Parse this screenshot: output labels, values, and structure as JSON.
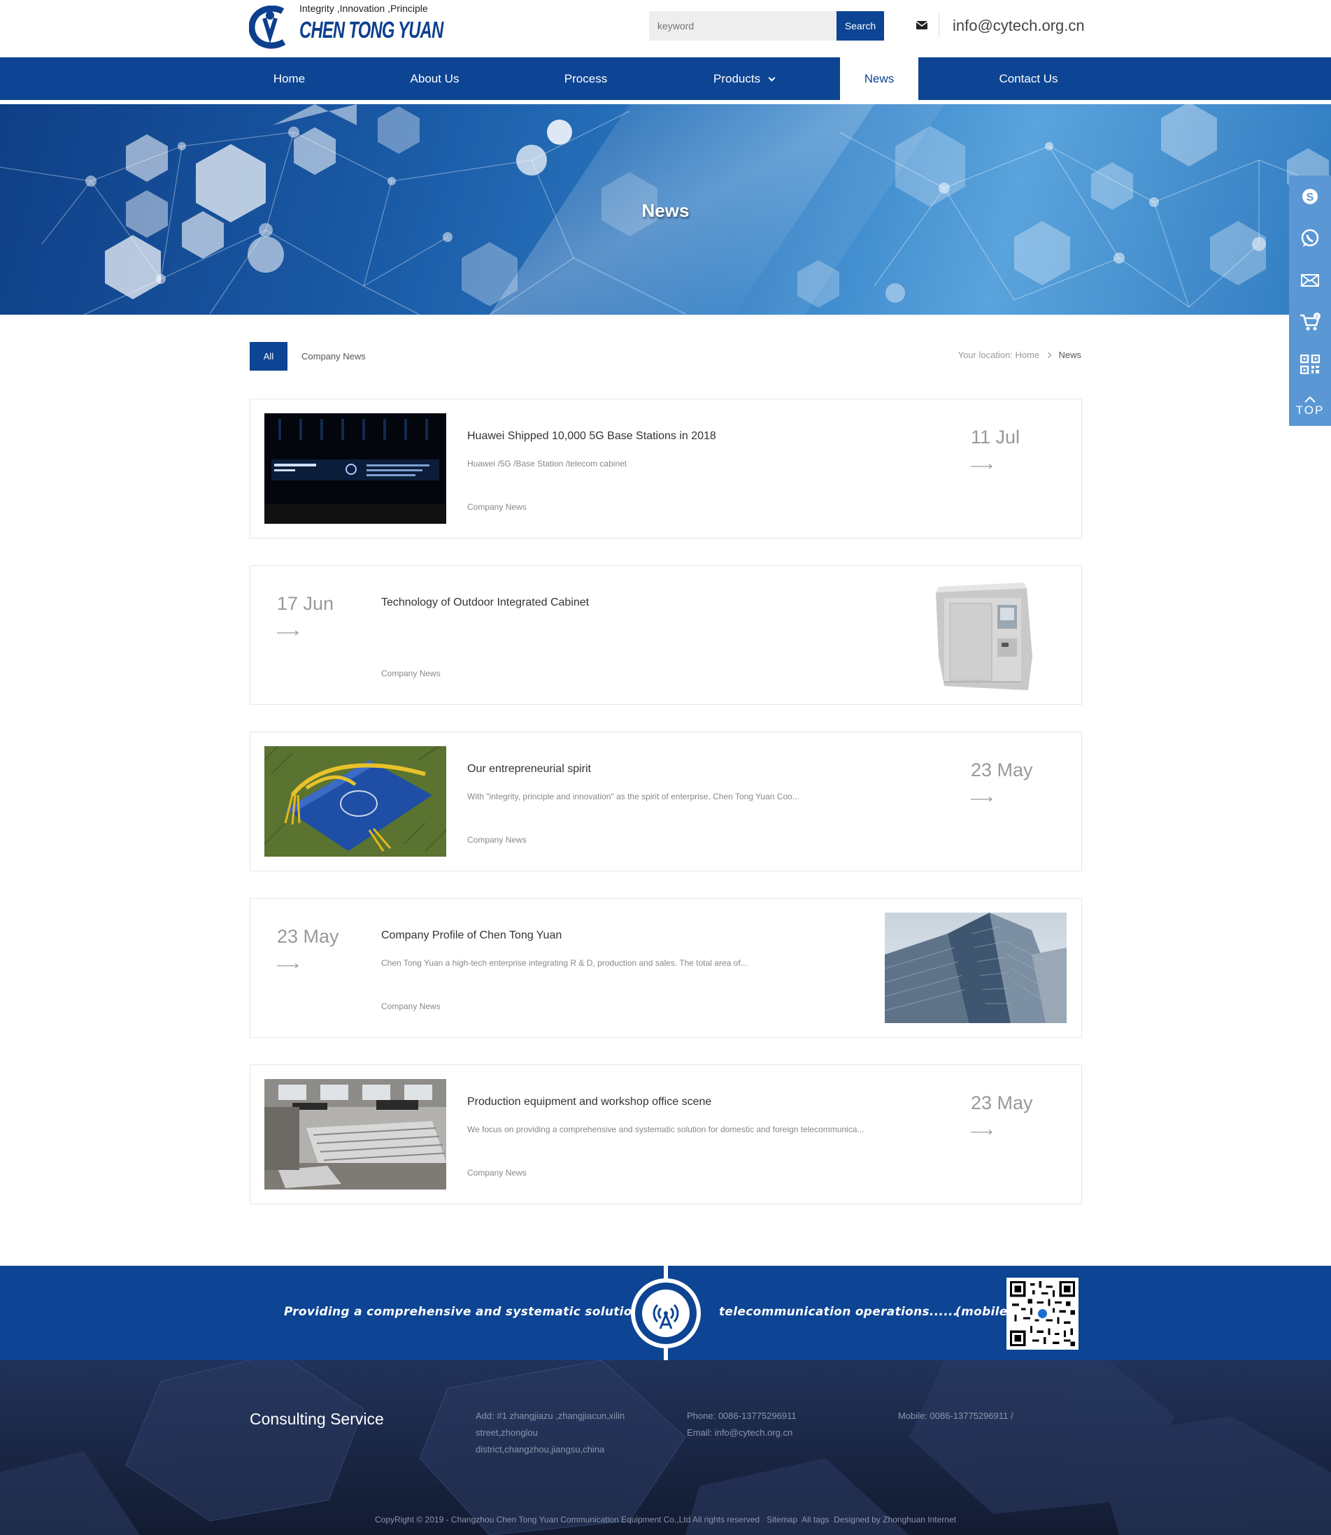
{
  "header": {
    "slogan": "Integrity ,Innovation ,Principle",
    "brand": "CHEN TONG YUAN",
    "search_placeholder": "keyword",
    "search_label": "Search",
    "email": "info@cytech.org.cn"
  },
  "nav": {
    "items": [
      {
        "label": "Home"
      },
      {
        "label": "About Us"
      },
      {
        "label": "Process"
      },
      {
        "label": "Products"
      },
      {
        "label": "News"
      },
      {
        "label": "Contact Us"
      }
    ],
    "active": "News"
  },
  "banner": {
    "title": "News"
  },
  "filters": {
    "all": "All",
    "company_news": "Company News"
  },
  "breadcrumb": {
    "prefix": "Your location:",
    "home": "Home",
    "current": "News"
  },
  "news": [
    {
      "title": "Huawei Shipped 10,000 5G Base Stations in 2018",
      "desc": "Huawei /5G /Base Station /telecom cabinet",
      "category": "Company News",
      "date": "11 Jul",
      "image": "5g-stage-photo"
    },
    {
      "title": "Technology of Outdoor Integrated Cabinet",
      "desc": "",
      "category": "Company News",
      "date": "17 Jun",
      "image": "outdoor-cabinet-photo"
    },
    {
      "title": "Our entrepreneurial spirit",
      "desc": "With \"integrity, principle and innovation\" as the spirit of enterprise, Chen Tong Yuan Coo...",
      "category": "Company News",
      "date": "23 May",
      "image": "certificate-photo"
    },
    {
      "title": "Company Profile of Chen Tong Yuan",
      "desc": "Chen Tong Yuan a high-tech enterprise integrating R & D, production and sales. The total area of...",
      "category": "Company News",
      "date": "23 May",
      "image": "building-photo"
    },
    {
      "title": "Production equipment and workshop office scene",
      "desc": "We focus on providing a comprehensive and systematic solution for domestic and foreign telecommunica...",
      "category": "Company News",
      "date": "23 May",
      "image": "workshop-photo"
    }
  ],
  "band": {
    "left": "Providing a comprehensive and systematic solution for",
    "right": "telecommunication operations......",
    "mobile": "(mobile)"
  },
  "footer": {
    "title": "Consulting Service",
    "address_1": "Add: #1 zhangjiazu ,zhangjiacun,xilin",
    "address_2": "street,zhonglou",
    "address_3": "district,changzhou,jiangsu,china",
    "phone": "Phone: 0086-13775296911",
    "email": "Email: info@cytech.org.cn",
    "mobile": "Mobile: 0086-13775296911 /",
    "copyright": "CopyRight © 2019 - Changzhou Chen Tong Yuan Communication Equipment Co.,Ltd All rights reserved",
    "sitemap": "Sitemap",
    "all_tags": "All tags",
    "designed": "Designed by Zhonghuan Internet"
  },
  "sidebar": {
    "top_label": "TOP"
  },
  "colors": {
    "primary": "#0d4493",
    "band": "#0d4493",
    "footer": "#1a2742",
    "sidebar": "#5b97d4"
  }
}
